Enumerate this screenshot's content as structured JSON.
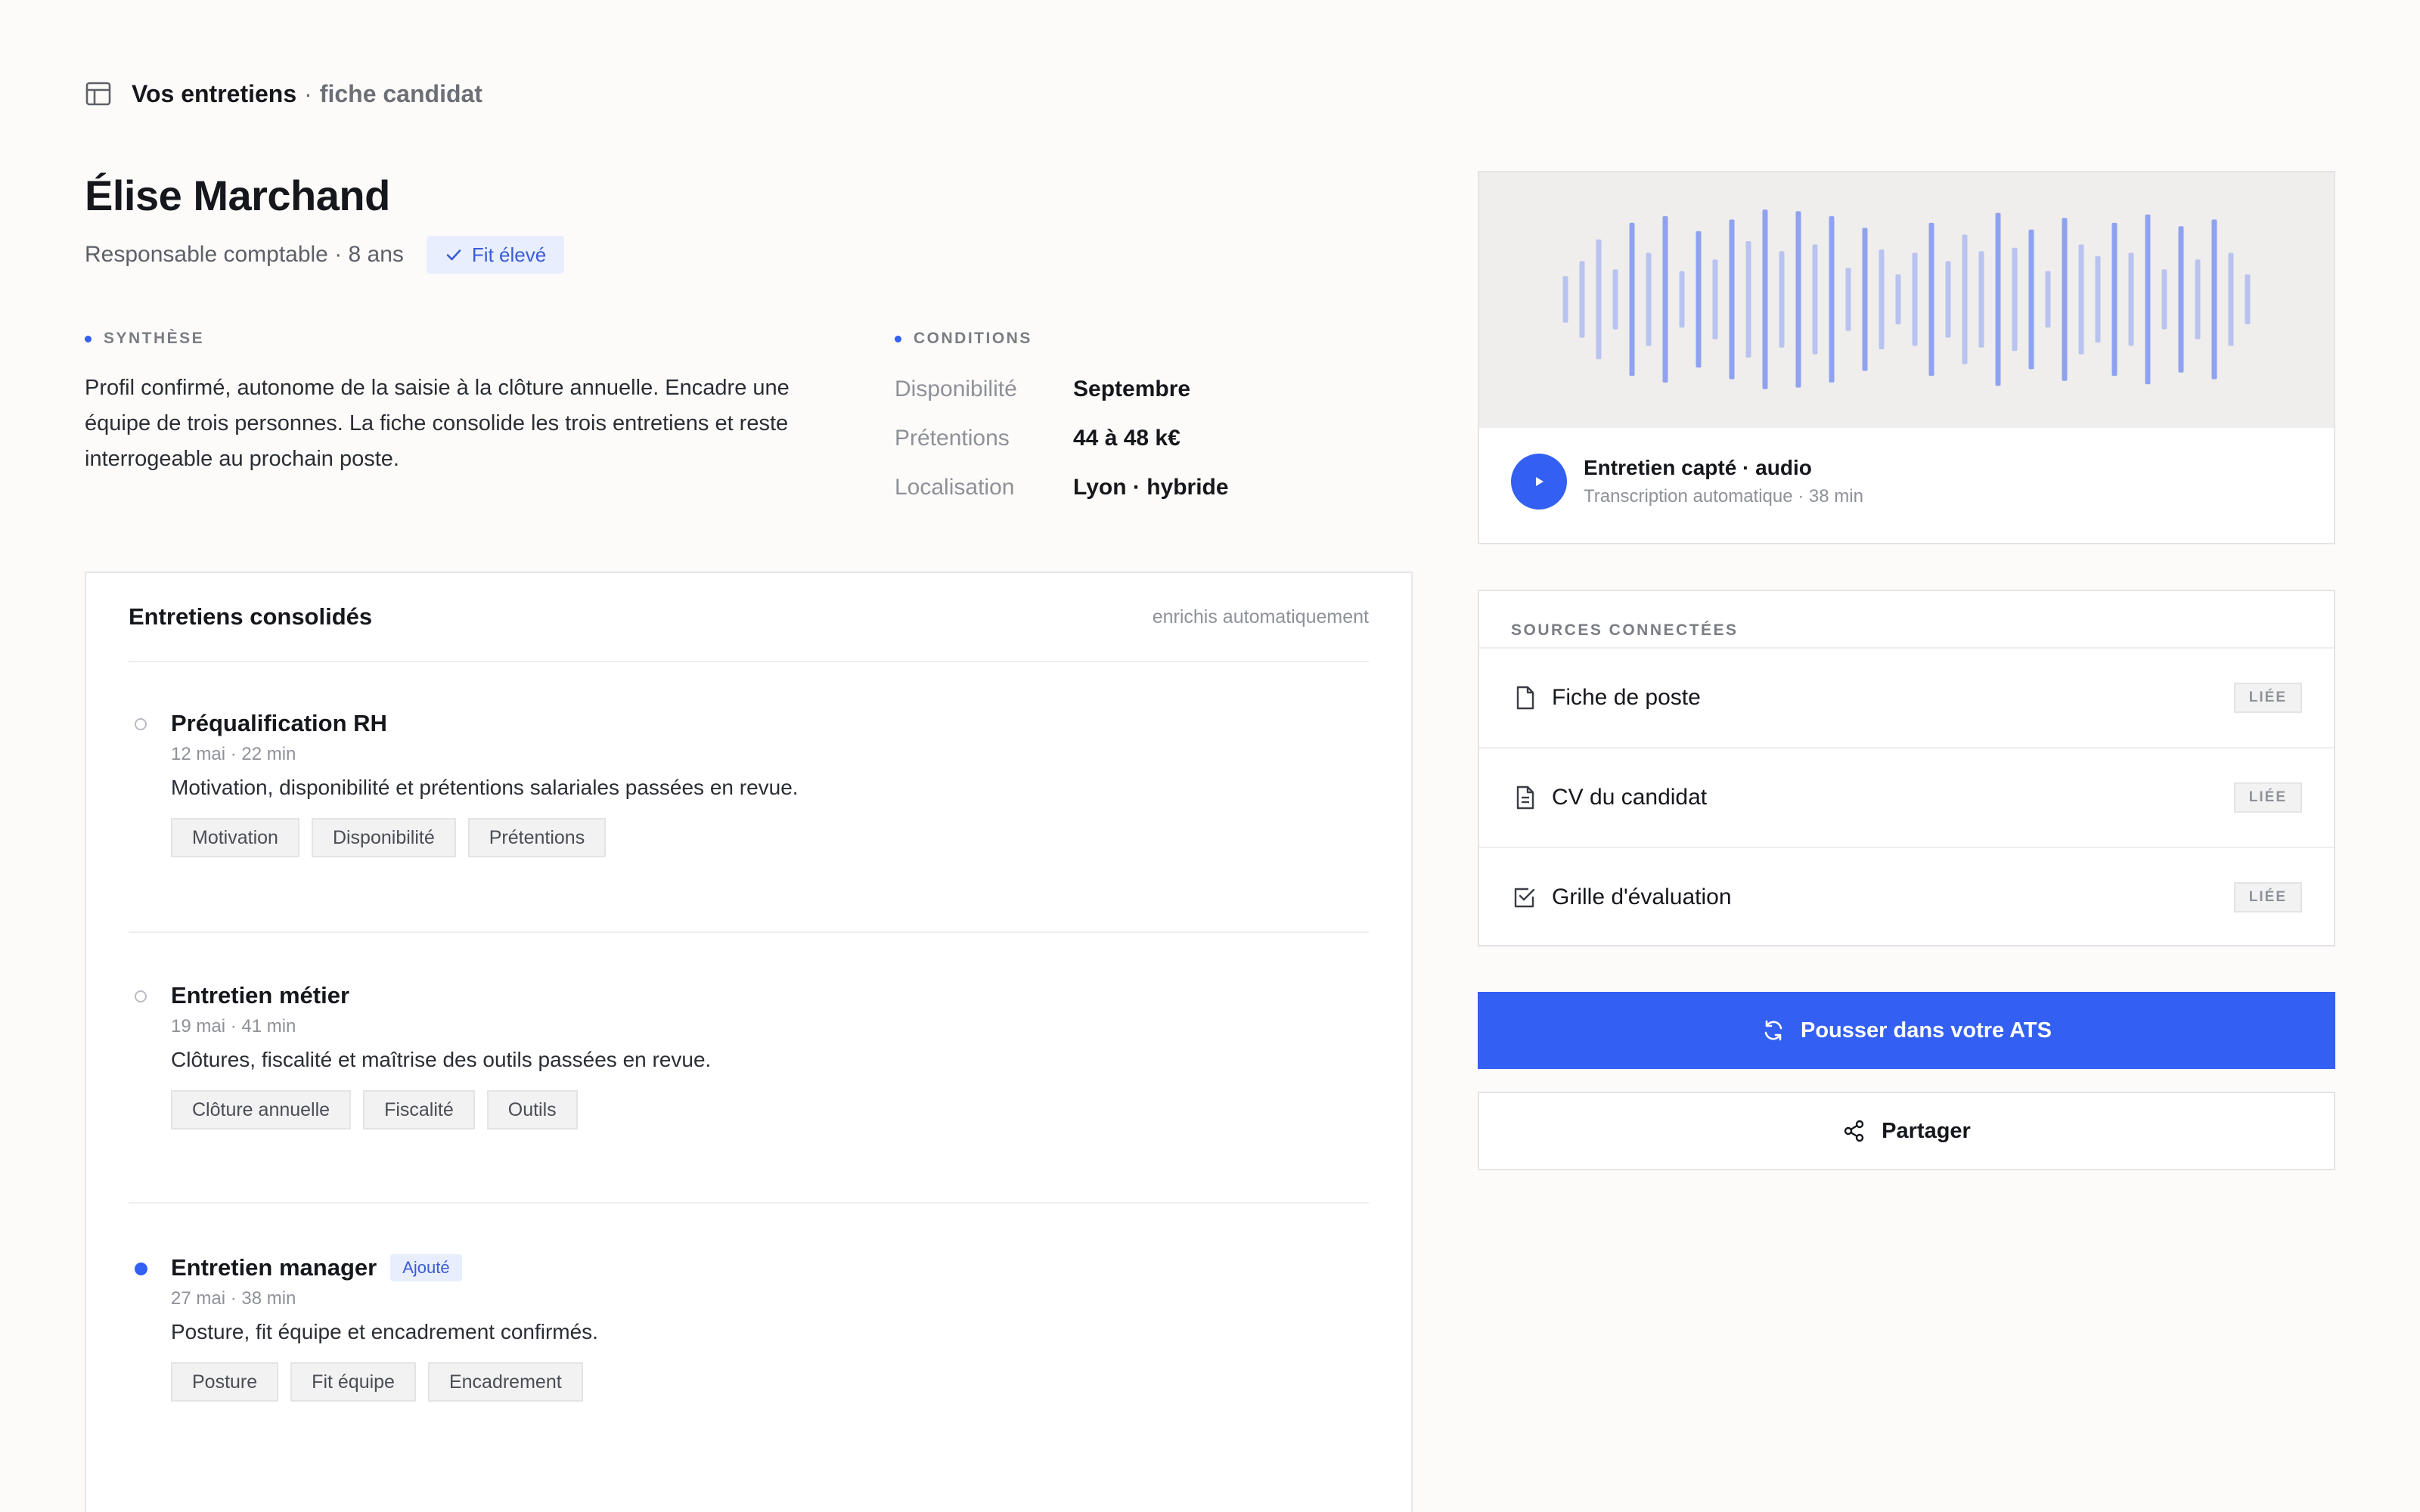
{
  "breadcrumb": {
    "icon": "layout-icon",
    "title": "Vos entretiens",
    "separator": "·",
    "subtitle": "fiche candidat"
  },
  "candidate": {
    "name": "Élise Marchand",
    "role": "Responsable comptable · 8 ans",
    "fit_badge": "Fit élevé"
  },
  "summary": {
    "label": "SYNTHÈSE",
    "text": "Profil confirmé, autonome de la saisie à la clôture annuelle. Encadre une équipe de trois personnes. La fiche consolide les trois entretiens et reste interrogeable au prochain poste."
  },
  "conditions": {
    "label": "CONDITIONS",
    "rows": [
      {
        "key": "Disponibilité",
        "value": "Septembre"
      },
      {
        "key": "Prétentions",
        "value": "44 à 48 k€"
      },
      {
        "key": "Localisation",
        "value": "Lyon · hybride"
      }
    ]
  },
  "interviews": {
    "title": "Entretiens consolidés",
    "note": "enrichis automatiquement",
    "items": [
      {
        "name": "Préqualification RH",
        "date": "12 mai · 22 min",
        "desc": "Motivation, disponibilité et prétentions salariales passées en revue.",
        "tags": [
          "Motivation",
          "Disponibilité",
          "Prétentions"
        ]
      },
      {
        "name": "Entretien métier",
        "date": "19 mai · 41 min",
        "desc": "Clôtures, fiscalité et maîtrise des outils passées en revue.",
        "tags": [
          "Clôture annuelle",
          "Fiscalité",
          "Outils"
        ]
      },
      {
        "name": "Entretien manager",
        "badge": "Ajouté",
        "date": "27 mai · 38 min",
        "desc": "Posture, fit équipe et encadrement confirmés.",
        "tags": [
          "Posture",
          "Fit équipe",
          "Encadrement"
        ]
      }
    ]
  },
  "audio": {
    "title": "Entretien capté · audio",
    "subtitle": "Transcription automatique · 38 min",
    "bars": [
      0.28,
      0.46,
      0.72,
      0.36,
      0.92,
      0.56,
      1.0,
      0.34,
      0.82,
      0.48,
      0.96,
      0.7,
      1.08,
      0.58,
      1.06,
      0.66,
      1.0,
      0.38,
      0.86,
      0.6,
      0.3,
      0.56,
      0.92,
      0.46,
      0.78,
      0.58,
      1.04,
      0.62,
      0.84,
      0.34,
      0.98,
      0.66,
      0.52,
      0.92,
      0.56,
      1.02,
      0.36,
      0.88,
      0.48,
      0.96,
      0.56,
      0.3
    ]
  },
  "sources": {
    "label": "SOURCES CONNECTÉES",
    "items": [
      {
        "name": "Fiche de poste",
        "badge": "LIÉE",
        "icon": "file-icon"
      },
      {
        "name": "CV du candidat",
        "badge": "LIÉE",
        "icon": "file-text-icon"
      },
      {
        "name": "Grille d'évaluation",
        "badge": "LIÉE",
        "icon": "checkbox-icon"
      }
    ]
  },
  "actions": {
    "primary_label": "Pousser dans votre ATS",
    "secondary_label": "Partager"
  },
  "colors": {
    "accent": "#3360f3",
    "accent_soft": "#e8eefd",
    "wave_light": "#b8c3f0",
    "wave_strong": "#8fa2ef"
  }
}
